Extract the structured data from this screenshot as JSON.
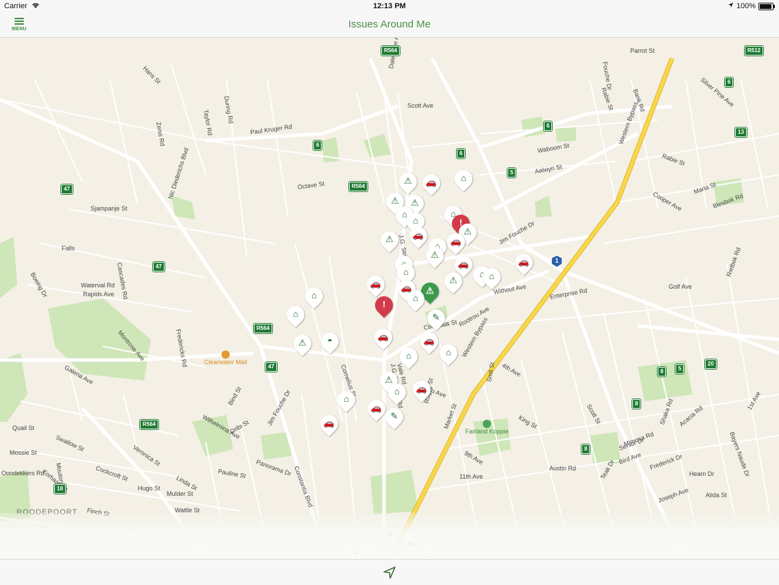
{
  "status_bar": {
    "carrier": "Carrier",
    "time": "12:13 PM",
    "battery": "100%"
  },
  "nav": {
    "menu_label": "MENU",
    "title": "Issues Around Me"
  },
  "map": {
    "streets": [
      {
        "text": "Paul Kruger Rd"
      },
      {
        "text": "Scott Ave"
      },
      {
        "text": "Octave St"
      },
      {
        "text": "Nic Diederichs Blvd"
      },
      {
        "text": "Sjampanje St"
      },
      {
        "text": "Waboom St"
      },
      {
        "text": "Aalwyn St"
      },
      {
        "text": "Rabie St"
      },
      {
        "text": "Rabie St"
      },
      {
        "text": "Jim Fouche Dr"
      },
      {
        "text": "Jim Fouche Dr"
      },
      {
        "text": "J.G. Strijdom Rd"
      },
      {
        "text": "J.G. Strijdom Rd"
      },
      {
        "text": "Western Bypass"
      },
      {
        "text": "Western Bypass"
      },
      {
        "text": "Without Ave"
      },
      {
        "text": "Enterprise Rd"
      },
      {
        "text": "Rootrou Ave"
      },
      {
        "text": "Cornelius St"
      },
      {
        "text": "Cornelius St"
      },
      {
        "text": "Constantia Blvd"
      },
      {
        "text": "Veronica St"
      },
      {
        "text": "Cockcroft St"
      },
      {
        "text": "Swallow St"
      },
      {
        "text": "Pauline St"
      },
      {
        "text": "Wilhelmina Ave"
      },
      {
        "text": "Panorama Dr"
      },
      {
        "text": "Hugo St"
      },
      {
        "text": "Mulder St"
      },
      {
        "text": "Finch St"
      },
      {
        "text": "Wattle St"
      },
      {
        "text": "Linda St"
      },
      {
        "text": "Galena Ave"
      },
      {
        "text": "Montrose Ave"
      },
      {
        "text": "Waterval Rd"
      },
      {
        "text": "Rapids Ave"
      },
      {
        "text": "Cascades Rd"
      },
      {
        "text": "Boeing Dr"
      },
      {
        "text": "Falls"
      },
      {
        "text": "Fredericks Rd"
      },
      {
        "text": "4th Ave"
      },
      {
        "text": "1st Ave"
      },
      {
        "text": "9th Ave"
      },
      {
        "text": "11th Ave"
      },
      {
        "text": "Smit St"
      },
      {
        "text": "Market St"
      },
      {
        "text": "King St"
      },
      {
        "text": "Scott St"
      },
      {
        "text": "Austin Rd"
      },
      {
        "text": "Mimosa Rd"
      },
      {
        "text": "Acacia Rd"
      },
      {
        "text": "Golf Ave"
      },
      {
        "text": "Rietbok Rd"
      },
      {
        "text": "Blesbok Rd"
      },
      {
        "text": "Maria St"
      },
      {
        "text": "Cooper Ave"
      },
      {
        "text": "Silver Pine Ave"
      },
      {
        "text": "Bank Rd"
      },
      {
        "text": "Parrot St"
      },
      {
        "text": "Fouche Dr"
      },
      {
        "text": "Hans St"
      },
      {
        "text": "Zeiss Rd"
      },
      {
        "text": "Taylor Rd"
      },
      {
        "text": "During Rd"
      },
      {
        "text": "Dale Lace Ave"
      },
      {
        "text": "Polo Ave"
      },
      {
        "text": "Rugby St"
      },
      {
        "text": "Vale Rd"
      },
      {
        "text": "Bind St"
      },
      {
        "text": "Oribi St"
      },
      {
        "text": "Quail St"
      },
      {
        "text": "Mossie St"
      },
      {
        "text": "Oondekkers Rd"
      },
      {
        "text": "Korhaan St"
      },
      {
        "text": "Mouton Rd"
      },
      {
        "text": "Bayers Naude Dr"
      },
      {
        "text": "Frederick Dr"
      },
      {
        "text": "Hearn Dr"
      },
      {
        "text": "Joseph Ave"
      },
      {
        "text": "Alida St"
      },
      {
        "text": "Shaka Rd"
      },
      {
        "text": "Senior Dr"
      },
      {
        "text": "Bird Ave"
      },
      {
        "text": "Teak Dr"
      }
    ],
    "route_badges": [
      {
        "text": "R564"
      },
      {
        "text": "R564"
      },
      {
        "text": "R564"
      },
      {
        "text": "R564"
      },
      {
        "text": "R512"
      },
      {
        "text": "47"
      },
      {
        "text": "47"
      },
      {
        "text": "47"
      },
      {
        "text": "6"
      },
      {
        "text": "6"
      },
      {
        "text": "6"
      },
      {
        "text": "6"
      },
      {
        "text": "5"
      },
      {
        "text": "5"
      },
      {
        "text": "13"
      },
      {
        "text": "8"
      },
      {
        "text": "8"
      },
      {
        "text": "8"
      },
      {
        "text": "8"
      },
      {
        "text": "20"
      },
      {
        "text": "18"
      }
    ],
    "shield_1": "1",
    "poi": "Clearwater Mall",
    "park": "Fairland Koppie",
    "suburb": "ROODEPOORT",
    "pins": [
      {
        "type": "white",
        "icon": "warning-icon",
        "glyph": "⚠"
      },
      {
        "type": "white",
        "icon": "vehicle-icon",
        "glyph": "🚗"
      },
      {
        "type": "white",
        "icon": "house-icon",
        "glyph": "⌂"
      },
      {
        "type": "white",
        "icon": "warning-icon",
        "glyph": "⚠"
      },
      {
        "type": "white",
        "icon": "warning-icon",
        "glyph": "⚠"
      },
      {
        "type": "white",
        "icon": "house-icon",
        "glyph": "⌂"
      },
      {
        "type": "white",
        "icon": "house-icon",
        "glyph": "⌂"
      },
      {
        "type": "white",
        "icon": "house-icon",
        "glyph": "⌂"
      },
      {
        "type": "red",
        "icon": "alert-icon",
        "glyph": "!"
      },
      {
        "type": "white",
        "icon": "warning-icon",
        "glyph": "⚠"
      },
      {
        "type": "white",
        "icon": "warning-icon",
        "glyph": "⚠"
      },
      {
        "type": "white",
        "icon": "vehicle-icon",
        "glyph": "🚗"
      },
      {
        "type": "white",
        "icon": "house-icon",
        "glyph": "⌂"
      },
      {
        "type": "white",
        "icon": "warning-icon",
        "glyph": "⚠"
      },
      {
        "type": "white",
        "icon": "vehicle-icon",
        "glyph": "🚗"
      },
      {
        "type": "white",
        "icon": "house-icon",
        "glyph": "⌂"
      },
      {
        "type": "white",
        "icon": "warning-icon",
        "glyph": "⚠"
      },
      {
        "type": "white",
        "icon": "vehicle-icon",
        "glyph": "🚗"
      },
      {
        "type": "white",
        "icon": "house-icon",
        "glyph": "⌂"
      },
      {
        "type": "white",
        "icon": "house-icon",
        "glyph": "⌂"
      },
      {
        "type": "white",
        "icon": "vehicle-icon",
        "glyph": "🚗"
      },
      {
        "type": "white",
        "icon": "house-icon",
        "glyph": "⌂"
      },
      {
        "type": "white",
        "icon": "vehicle-icon",
        "glyph": "🚗"
      },
      {
        "type": "white",
        "icon": "vehicle-icon",
        "glyph": "🚗"
      },
      {
        "type": "green",
        "icon": "warning-icon",
        "glyph": "⚠"
      },
      {
        "type": "white",
        "icon": "house-icon",
        "glyph": "⌂"
      },
      {
        "type": "red",
        "icon": "alert-icon",
        "glyph": "!"
      },
      {
        "type": "white",
        "icon": "wrench-icon",
        "glyph": "✎"
      },
      {
        "type": "white",
        "icon": "house-icon",
        "glyph": "⌂"
      },
      {
        "type": "white",
        "icon": "house-icon",
        "glyph": "⌂"
      },
      {
        "type": "white",
        "icon": "hat-icon",
        "glyph": "◓"
      },
      {
        "type": "white",
        "icon": "warning-icon",
        "glyph": "⚠"
      },
      {
        "type": "white",
        "icon": "vehicle-icon",
        "glyph": "🚗"
      },
      {
        "type": "white",
        "icon": "vehicle-icon",
        "glyph": "🚗"
      },
      {
        "type": "white",
        "icon": "house-icon",
        "glyph": "⌂"
      },
      {
        "type": "white",
        "icon": "warning-icon",
        "glyph": "⚠"
      },
      {
        "type": "white",
        "icon": "house-icon",
        "glyph": "⌂"
      },
      {
        "type": "white",
        "icon": "vehicle-icon",
        "glyph": "🚗"
      },
      {
        "type": "white",
        "icon": "wrench-icon",
        "glyph": "✎"
      },
      {
        "type": "white",
        "icon": "vehicle-icon",
        "glyph": "🚗"
      },
      {
        "type": "white",
        "icon": "house-icon",
        "glyph": "⌂"
      },
      {
        "type": "white",
        "icon": "house-icon",
        "glyph": "⌂"
      },
      {
        "type": "white",
        "icon": "vehicle-icon",
        "glyph": "🚗"
      },
      {
        "type": "white",
        "icon": "warning-icon",
        "glyph": "⚠"
      },
      {
        "type": "white",
        "icon": "shield-icon",
        "glyph": "✚"
      },
      {
        "type": "white",
        "icon": "vehicle-icon",
        "glyph": "🚗"
      },
      {
        "type": "white",
        "icon": "gear-icon",
        "glyph": "✱"
      },
      {
        "type": "white",
        "icon": "wrench-icon",
        "glyph": "✎"
      }
    ]
  },
  "toolbar": {
    "locate_icon": "location-arrow-icon"
  },
  "colors": {
    "accent": "#4a8f45",
    "pin_green": "#1f6b2c",
    "pin_red": "#d33a4a",
    "route": "#1f7a32",
    "highway": "#f2cf3a"
  }
}
